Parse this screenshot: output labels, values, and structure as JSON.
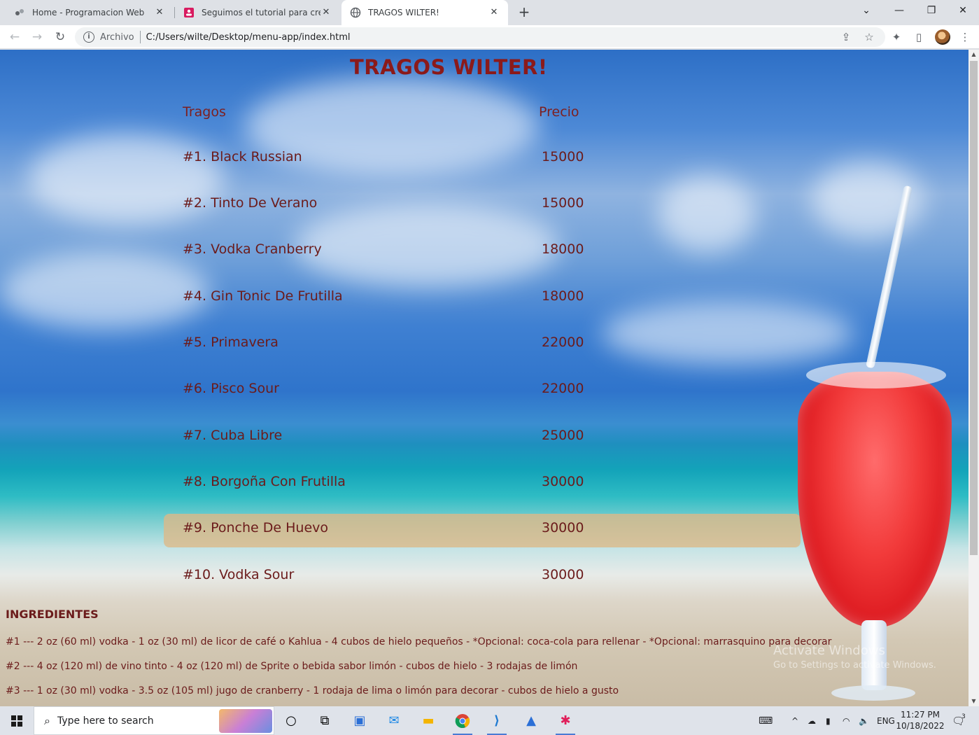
{
  "browser": {
    "tabs": [
      {
        "title": "Home - Programacion Web",
        "favicon": "wordpress-icon"
      },
      {
        "title": "Seguimos el tutorial para crear nu",
        "favicon": "presentation-icon"
      },
      {
        "title": "TRAGOS WILTER!",
        "favicon": "globe-icon"
      }
    ],
    "scheme_label": "Archivo",
    "url": "C:/Users/wilte/Desktop/menu-app/index.html"
  },
  "page": {
    "title": "TRAGOS WILTER!",
    "col_drinks": "Tragos",
    "col_price": "Precio",
    "drinks": [
      {
        "name": "#1. Black Russian",
        "price": "15000"
      },
      {
        "name": "#2. Tinto De Verano",
        "price": "15000"
      },
      {
        "name": "#3. Vodka Cranberry",
        "price": "18000"
      },
      {
        "name": "#4. Gin Tonic De Frutilla",
        "price": "18000"
      },
      {
        "name": "#5. Primavera",
        "price": "22000"
      },
      {
        "name": "#6. Pisco Sour",
        "price": "22000"
      },
      {
        "name": "#7. Cuba Libre",
        "price": "25000"
      },
      {
        "name": "#8. Borgoña Con Frutilla",
        "price": "30000"
      },
      {
        "name": "#9. Ponche De Huevo",
        "price": "30000"
      },
      {
        "name": "#10. Vodka Sour",
        "price": "30000"
      }
    ],
    "highlighted_row": 9,
    "ingredients_title": "INGREDIENTES",
    "ingredients": [
      "#1 --- 2 oz (60 ml) vodka - 1 oz (30 ml) de licor de café o Kahlua - 4 cubos de hielo pequeños - *Opcional: coca-cola para rellenar - *Opcional: marrasquino para decorar",
      "#2 --- 4 oz (120 ml) de vino tinto - 4 oz (120 ml) de Sprite o bebida sabor limón - cubos de hielo - 3 rodajas de limón",
      "#3 --- 1 oz (30 ml) vodka - 3.5 oz (105 ml) jugo de cranberry - 1 rodaja de lima o limón para decorar - cubos de hielo a gusto"
    ],
    "accent_color": "#8b1a1a"
  },
  "watermark": {
    "line1": "Activate Windows",
    "line2": "Go to Settings to activate Windows."
  },
  "taskbar": {
    "search_placeholder": "Type here to search",
    "language": "ENG",
    "time": "11:27 PM",
    "date": "10/18/2022",
    "notification_count": "3"
  }
}
